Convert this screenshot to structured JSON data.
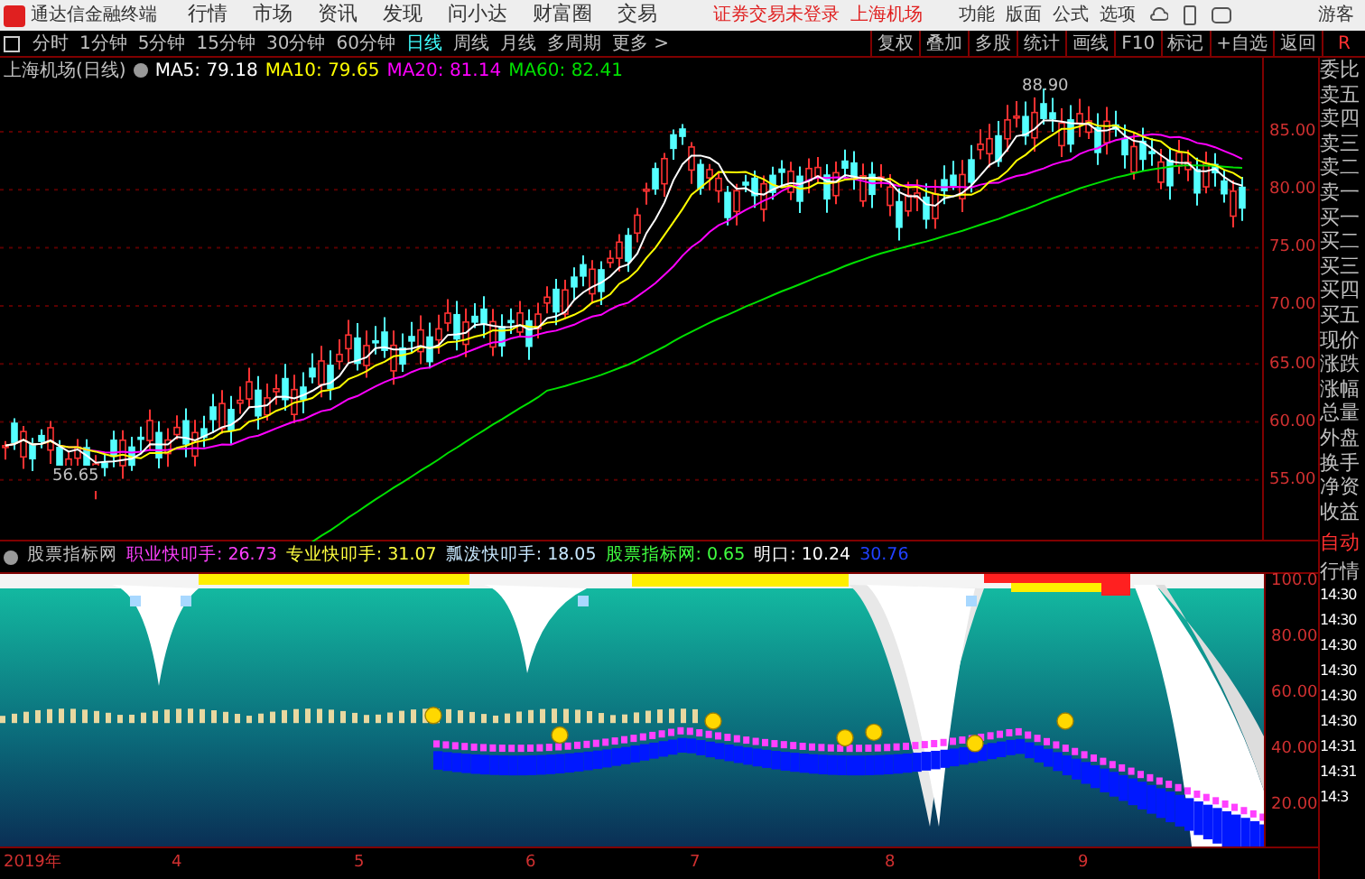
{
  "menu_bar": {
    "app_title": "通达信金融终端",
    "menus": [
      "行情",
      "市场",
      "资讯",
      "发现",
      "问小达",
      "财富圈",
      "交易"
    ],
    "status": [
      "证券交易未登录",
      "上海机场"
    ],
    "actions": [
      "功能",
      "版面",
      "公式",
      "选项"
    ],
    "user": "游客"
  },
  "period_tabs": [
    {
      "label": "分时",
      "selected": false
    },
    {
      "label": "1分钟",
      "selected": false
    },
    {
      "label": "5分钟",
      "selected": false
    },
    {
      "label": "15分钟",
      "selected": false
    },
    {
      "label": "30分钟",
      "selected": false
    },
    {
      "label": "60分钟",
      "selected": false
    },
    {
      "label": "日线",
      "selected": true
    },
    {
      "label": "周线",
      "selected": false
    },
    {
      "label": "月线",
      "selected": false
    },
    {
      "label": "多周期",
      "selected": false
    },
    {
      "label": "更多 >",
      "selected": false
    }
  ],
  "chart_tools": [
    "复权",
    "叠加",
    "多股",
    "统计",
    "画线",
    "F10",
    "标记",
    "+自选",
    "返回"
  ],
  "toolbar_badge": "R",
  "price_chart": {
    "title": "上海机场(日线)",
    "indicators": [
      {
        "text": "MA5: 79.18",
        "color": "#ffffff"
      },
      {
        "text": "MA10: 79.65",
        "color": "#ffff00"
      },
      {
        "text": "MA20: 81.14",
        "color": "#ff00ff"
      },
      {
        "text": "MA60: 82.41",
        "color": "#00e000"
      }
    ],
    "high_marker": "88.90",
    "low_marker": "56.65",
    "price_ticks": [
      "85.00",
      "80.00",
      "75.00",
      "70.00",
      "65.00",
      "60.00",
      "55.00"
    ]
  },
  "indicator_panel": {
    "legend": [
      {
        "text": "股票指标网",
        "color": "#c0c0c0"
      },
      {
        "text": "职业快叩手: 26.73",
        "color": "#ff40ff"
      },
      {
        "text": "专业快叩手: 31.07",
        "color": "#ffff40"
      },
      {
        "text": "瓢泼快叩手: 18.05",
        "color": "#c8e8ff"
      },
      {
        "text": "股票指标网: 0.65",
        "color": "#40ff40"
      },
      {
        "text": "明口: 10.24",
        "color": "#ffffff"
      },
      {
        "text": "30.76",
        "color": "#2040ff"
      }
    ],
    "ticks": [
      "100.0",
      "80.00",
      "60.00",
      "40.00",
      "20.00"
    ]
  },
  "date_axis": [
    "2019年",
    "4",
    "5",
    "6",
    "7",
    "8",
    "9"
  ],
  "quote_panel": {
    "labels": [
      "委比",
      "卖五",
      "卖四",
      "卖三",
      "卖二",
      "卖一",
      "买一",
      "买二",
      "买三",
      "买四",
      "买五",
      "现价",
      "涨跌",
      "涨幅",
      "总量",
      "外盘",
      "换手",
      "净资",
      "收益"
    ],
    "mode": "自动",
    "tab": "行情",
    "times": [
      "14:30",
      "14:30",
      "14:30",
      "14:30",
      "14:30",
      "14:30",
      "14:31",
      "14:31",
      "14:3"
    ]
  }
}
